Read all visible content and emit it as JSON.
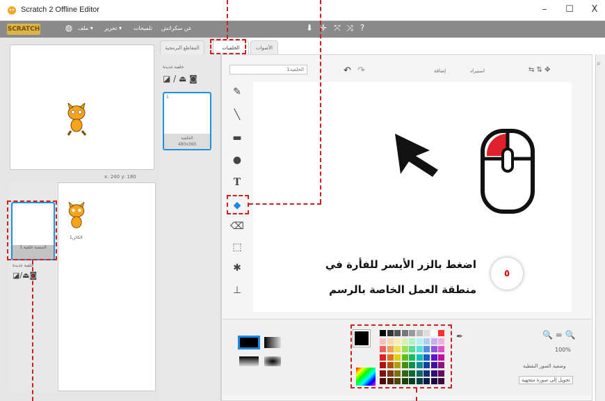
{
  "window": {
    "title": "Scratch 2 Offline Editor",
    "controls": {
      "minimize": "–",
      "maximize": "☐",
      "close": "X"
    }
  },
  "menubar": {
    "logo": "SCRATCH",
    "items": [
      "ملف ▾",
      "تحرير ▾",
      "تلميحات",
      "عن سكراتش"
    ]
  },
  "stage": {
    "coords": "x: 240  y: 180"
  },
  "sprites": {
    "stage_thumb_caption": "المنصة خلفية 1",
    "new_backdrop_label": "خلفية جديدة",
    "sprite_name": "الكائن1"
  },
  "tabs": {
    "scripts": "المقاطع البرمجية",
    "backdrops": "الخلفيات",
    "sounds": "الأصوات"
  },
  "costumes": {
    "new_label": "خلفية جديدة",
    "item_number": "1",
    "item_name": "الخلفية",
    "item_size": "480x360"
  },
  "editor": {
    "costume_name_value": "الخلفية1",
    "clear_label": "إضافة",
    "import_label": "استيراد",
    "zoom_level": "100%",
    "mode_label": "وضعية الصور النقطية",
    "convert_label": "تحويل إلى صورة متجهية"
  },
  "annotation": {
    "line1": "اضغط بالزر الأيسر للفأرة في",
    "line2": "منطقة العمل الخاصة بالرسم",
    "step": "٥"
  },
  "colors": {
    "accent": "#cc1f1f",
    "selection": "#1e90e0",
    "menubar": "#8a8a8a"
  }
}
